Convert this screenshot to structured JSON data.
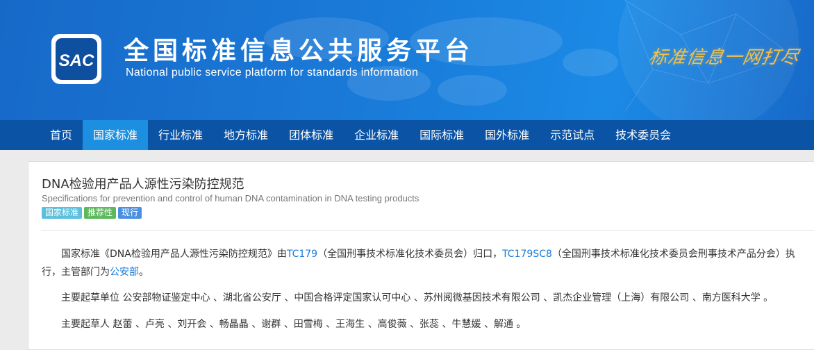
{
  "header": {
    "logo_text": "SAC",
    "title_cn": "全国标准信息公共服务平台",
    "title_en": "National public service platform  for standards information",
    "slogan": "标准信息一网打尽"
  },
  "nav": {
    "items": [
      "首页",
      "国家标准",
      "行业标准",
      "地方标准",
      "团体标准",
      "企业标准",
      "国际标准",
      "国外标准",
      "示范试点",
      "技术委员会"
    ],
    "active_index": 1
  },
  "standard": {
    "title_cn": "DNA检验用产品人源性污染防控规范",
    "title_en": "Specifications for prevention and control of human DNA contamination in DNA testing products",
    "badges": [
      "国家标准",
      "推荐性",
      "现行"
    ]
  },
  "description": {
    "p1_a": "国家标准《DNA检验用产品人源性污染防控规范》由",
    "tc_link": "TC179",
    "p1_b": "（全国刑事技术标准化技术委员会）归口，",
    "sc_link": "TC179SC8",
    "p1_c": "（全国刑事技术标准化技术委员会刑事技术产品分会）执行，主管部门为",
    "dept_link": "公安部",
    "p1_d": "。",
    "drafting_units": "主要起草单位 公安部物证鉴定中心 、湖北省公安厅 、中国合格评定国家认可中心 、苏州阅微基因技术有限公司 、凯杰企业管理（上海）有限公司 、南方医科大学 。",
    "drafters": "主要起草人 赵蕾 、卢亮 、刘开会 、畅晶晶 、谢群 、田雪梅 、王海生 、高俊薇 、张蕊 、牛慧媛 、解通 。"
  },
  "colors": {
    "header_blue": "#1a7ad8",
    "nav_blue": "#0b54a5",
    "nav_active": "#1c8fe0",
    "link": "#1a7ad8",
    "slogan_gold": "#f2c14a"
  }
}
